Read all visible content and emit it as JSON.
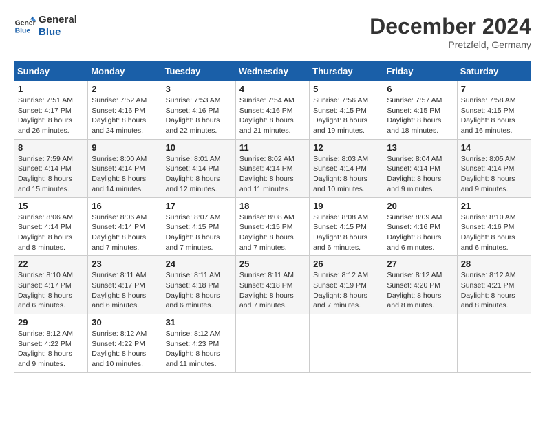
{
  "header": {
    "logo_line1": "General",
    "logo_line2": "Blue",
    "month_year": "December 2024",
    "location": "Pretzfeld, Germany"
  },
  "days_of_week": [
    "Sunday",
    "Monday",
    "Tuesday",
    "Wednesday",
    "Thursday",
    "Friday",
    "Saturday"
  ],
  "weeks": [
    [
      {
        "day": "1",
        "sunrise": "7:51 AM",
        "sunset": "4:17 PM",
        "daylight": "8 hours and 26 minutes."
      },
      {
        "day": "2",
        "sunrise": "7:52 AM",
        "sunset": "4:16 PM",
        "daylight": "8 hours and 24 minutes."
      },
      {
        "day": "3",
        "sunrise": "7:53 AM",
        "sunset": "4:16 PM",
        "daylight": "8 hours and 22 minutes."
      },
      {
        "day": "4",
        "sunrise": "7:54 AM",
        "sunset": "4:16 PM",
        "daylight": "8 hours and 21 minutes."
      },
      {
        "day": "5",
        "sunrise": "7:56 AM",
        "sunset": "4:15 PM",
        "daylight": "8 hours and 19 minutes."
      },
      {
        "day": "6",
        "sunrise": "7:57 AM",
        "sunset": "4:15 PM",
        "daylight": "8 hours and 18 minutes."
      },
      {
        "day": "7",
        "sunrise": "7:58 AM",
        "sunset": "4:15 PM",
        "daylight": "8 hours and 16 minutes."
      }
    ],
    [
      {
        "day": "8",
        "sunrise": "7:59 AM",
        "sunset": "4:14 PM",
        "daylight": "8 hours and 15 minutes."
      },
      {
        "day": "9",
        "sunrise": "8:00 AM",
        "sunset": "4:14 PM",
        "daylight": "8 hours and 14 minutes."
      },
      {
        "day": "10",
        "sunrise": "8:01 AM",
        "sunset": "4:14 PM",
        "daylight": "8 hours and 12 minutes."
      },
      {
        "day": "11",
        "sunrise": "8:02 AM",
        "sunset": "4:14 PM",
        "daylight": "8 hours and 11 minutes."
      },
      {
        "day": "12",
        "sunrise": "8:03 AM",
        "sunset": "4:14 PM",
        "daylight": "8 hours and 10 minutes."
      },
      {
        "day": "13",
        "sunrise": "8:04 AM",
        "sunset": "4:14 PM",
        "daylight": "8 hours and 9 minutes."
      },
      {
        "day": "14",
        "sunrise": "8:05 AM",
        "sunset": "4:14 PM",
        "daylight": "8 hours and 9 minutes."
      }
    ],
    [
      {
        "day": "15",
        "sunrise": "8:06 AM",
        "sunset": "4:14 PM",
        "daylight": "8 hours and 8 minutes."
      },
      {
        "day": "16",
        "sunrise": "8:06 AM",
        "sunset": "4:14 PM",
        "daylight": "8 hours and 7 minutes."
      },
      {
        "day": "17",
        "sunrise": "8:07 AM",
        "sunset": "4:15 PM",
        "daylight": "8 hours and 7 minutes."
      },
      {
        "day": "18",
        "sunrise": "8:08 AM",
        "sunset": "4:15 PM",
        "daylight": "8 hours and 7 minutes."
      },
      {
        "day": "19",
        "sunrise": "8:08 AM",
        "sunset": "4:15 PM",
        "daylight": "8 hours and 6 minutes."
      },
      {
        "day": "20",
        "sunrise": "8:09 AM",
        "sunset": "4:16 PM",
        "daylight": "8 hours and 6 minutes."
      },
      {
        "day": "21",
        "sunrise": "8:10 AM",
        "sunset": "4:16 PM",
        "daylight": "8 hours and 6 minutes."
      }
    ],
    [
      {
        "day": "22",
        "sunrise": "8:10 AM",
        "sunset": "4:17 PM",
        "daylight": "8 hours and 6 minutes."
      },
      {
        "day": "23",
        "sunrise": "8:11 AM",
        "sunset": "4:17 PM",
        "daylight": "8 hours and 6 minutes."
      },
      {
        "day": "24",
        "sunrise": "8:11 AM",
        "sunset": "4:18 PM",
        "daylight": "8 hours and 6 minutes."
      },
      {
        "day": "25",
        "sunrise": "8:11 AM",
        "sunset": "4:18 PM",
        "daylight": "8 hours and 7 minutes."
      },
      {
        "day": "26",
        "sunrise": "8:12 AM",
        "sunset": "4:19 PM",
        "daylight": "8 hours and 7 minutes."
      },
      {
        "day": "27",
        "sunrise": "8:12 AM",
        "sunset": "4:20 PM",
        "daylight": "8 hours and 8 minutes."
      },
      {
        "day": "28",
        "sunrise": "8:12 AM",
        "sunset": "4:21 PM",
        "daylight": "8 hours and 8 minutes."
      }
    ],
    [
      {
        "day": "29",
        "sunrise": "8:12 AM",
        "sunset": "4:22 PM",
        "daylight": "8 hours and 9 minutes."
      },
      {
        "day": "30",
        "sunrise": "8:12 AM",
        "sunset": "4:22 PM",
        "daylight": "8 hours and 10 minutes."
      },
      {
        "day": "31",
        "sunrise": "8:12 AM",
        "sunset": "4:23 PM",
        "daylight": "8 hours and 11 minutes."
      },
      null,
      null,
      null,
      null
    ]
  ]
}
